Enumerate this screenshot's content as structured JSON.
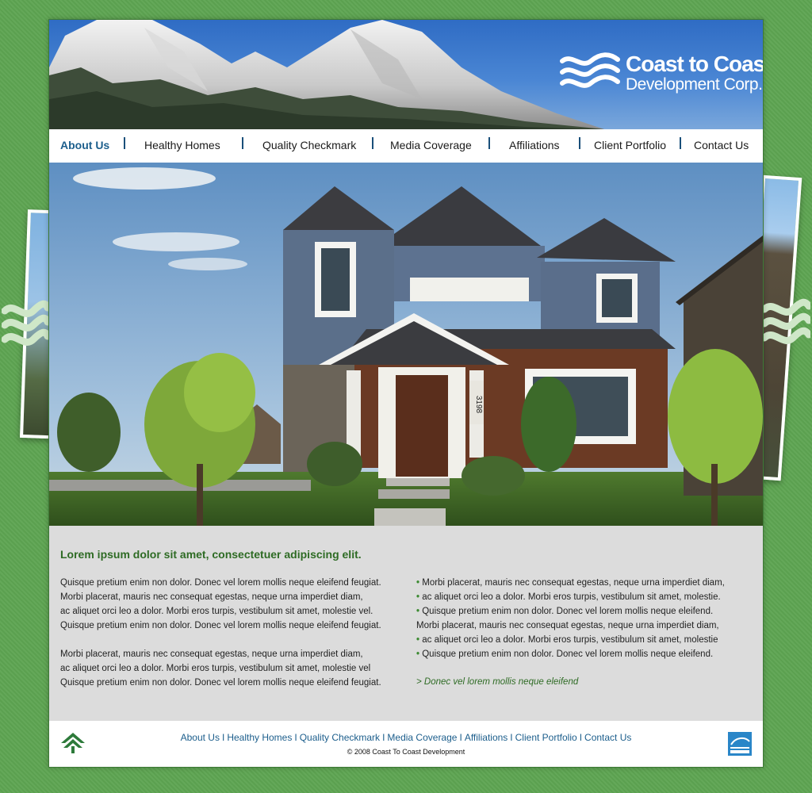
{
  "brand": {
    "name_line1": "Coast to Coast",
    "name_line2": "Development Corp."
  },
  "nav": {
    "items": [
      {
        "label": "About Us",
        "active": true
      },
      {
        "label": "Healthy Homes"
      },
      {
        "label": "Quality Checkmark"
      },
      {
        "label": "Media Coverage"
      },
      {
        "label": "Affiliations"
      },
      {
        "label": "Client Portfolio"
      },
      {
        "label": "Contact Us"
      }
    ]
  },
  "hero": {
    "house_number": "3198"
  },
  "content": {
    "headline": "Lorem ipsum dolor sit amet, consectetuer adipiscing elit.",
    "left_paragraphs": [
      [
        "Quisque pretium enim non dolor. Donec vel lorem mollis neque eleifend feugiat.",
        "Morbi placerat, mauris nec consequat egestas, neque urna imperdiet diam,",
        "ac aliquet orci leo a dolor. Morbi eros turpis, vestibulum sit amet, molestie vel.",
        "Quisque pretium enim non dolor. Donec vel lorem mollis neque eleifend feugiat."
      ],
      [
        "Morbi placerat, mauris nec consequat egestas, neque urna imperdiet diam,",
        "ac aliquet orci leo a dolor. Morbi eros turpis, vestibulum sit amet, molestie vel",
        "Quisque pretium enim non dolor. Donec vel lorem mollis neque eleifend feugiat."
      ]
    ],
    "right_lines": [
      {
        "bullet": true,
        "text": "Morbi placerat, mauris nec consequat egestas, neque urna imperdiet diam,"
      },
      {
        "bullet": true,
        "text": "ac aliquet orci leo a dolor. Morbi eros turpis, vestibulum sit amet, molestie."
      },
      {
        "bullet": true,
        "text": "Quisque pretium enim non dolor. Donec vel lorem mollis neque eleifend."
      },
      {
        "bullet": false,
        "text": "Morbi placerat, mauris nec consequat egestas, neque urna imperdiet diam,"
      },
      {
        "bullet": true,
        "text": "ac aliquet orci leo a dolor. Morbi eros turpis, vestibulum sit amet, molestie"
      },
      {
        "bullet": true,
        "text": "Quisque pretium enim non dolor. Donec vel lorem mollis neque eleifend."
      }
    ],
    "bullet_char": "•",
    "more_link": "> Donec vel lorem mollis neque eleifend"
  },
  "footer": {
    "links": [
      "About Us",
      "Healthy Homes",
      "Quality Checkmark",
      "Media Coverage",
      "Affiliations",
      "Client Portfolio",
      "Contact Us"
    ],
    "separator": "I",
    "copyright": "© 2008 Coast To Coast Development"
  },
  "colors": {
    "page_bg": "#5ea552",
    "nav_active": "#1c5e8c",
    "headline_green": "#2e6b24",
    "content_bg": "#dcdcdc"
  },
  "icons": {
    "logo": "wave-logo-icon",
    "footer_left": "tree-house-icon",
    "footer_right": "energy-star-icon"
  }
}
